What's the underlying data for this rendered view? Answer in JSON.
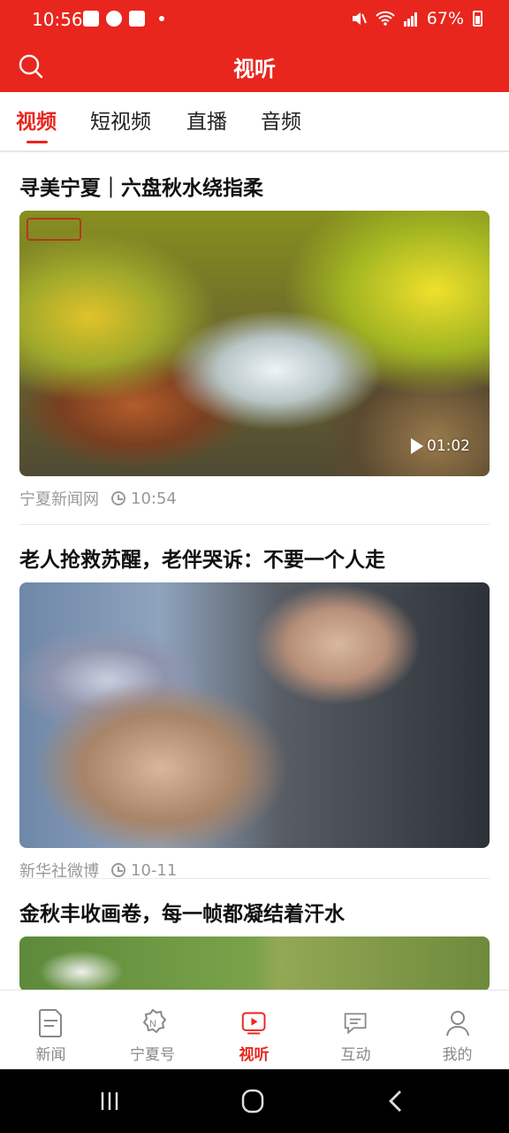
{
  "status_bar": {
    "time": "10:56",
    "battery": "67%"
  },
  "header": {
    "title": "视听"
  },
  "tabs": [
    {
      "label": "视频",
      "active": true
    },
    {
      "label": "短视频"
    },
    {
      "label": "直播"
    },
    {
      "label": "音频"
    }
  ],
  "articles": [
    {
      "title": "寻美宁夏｜六盘秋水绕指柔",
      "source": "宁夏新闻网",
      "time": "10:54",
      "duration": "01:02",
      "thumbnail": "autumn stream with yellow foliage and rocks"
    },
    {
      "title": "老人抢救苏醒，老伴哭诉：不要一个人走",
      "source": "新华社微博",
      "time": "10-11",
      "thumbnail": "elderly man caring for woman in hospital bed"
    },
    {
      "title": "金秋丰收画卷，每一帧都凝结着汗水",
      "thumbnail": "green field harvest scene"
    }
  ],
  "bottom_nav": [
    {
      "label": "新闻",
      "icon": "news-icon"
    },
    {
      "label": "宁夏号",
      "icon": "ningxia-badge-icon"
    },
    {
      "label": "视听",
      "icon": "video-play-icon",
      "active": true
    },
    {
      "label": "互动",
      "icon": "chat-icon"
    },
    {
      "label": "我的",
      "icon": "profile-icon"
    }
  ],
  "colors": {
    "brand_red": "#e8261e",
    "meta_gray": "#999999"
  }
}
